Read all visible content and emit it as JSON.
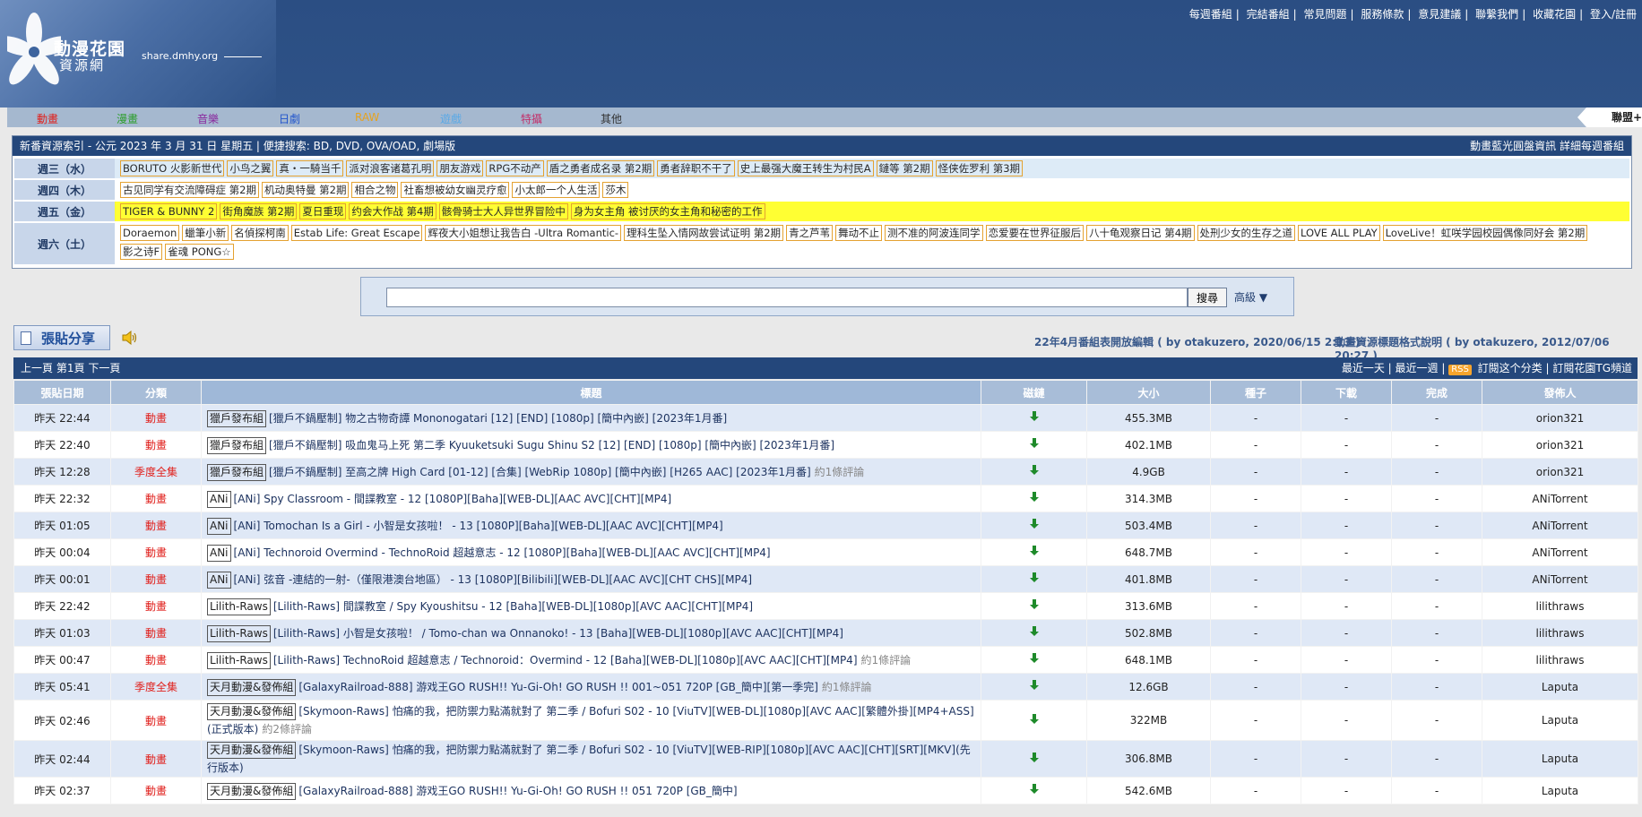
{
  "site": {
    "logo_title": "動漫花園",
    "logo_sub": "資源網",
    "domain": "share.dmhy.org"
  },
  "toplinks": [
    "每週番組",
    "完結番組",
    "常見問題",
    "服務條款",
    "意見建議",
    "聯繫我們",
    "收藏花園",
    "登入/註冊"
  ],
  "nav": [
    {
      "label": "動畫",
      "color": "#e0211d"
    },
    {
      "label": "漫畫",
      "color": "#2f9e2f"
    },
    {
      "label": "音樂",
      "color": "#8a2a9e"
    },
    {
      "label": "日劇",
      "color": "#2255cc"
    },
    {
      "label": "RAW",
      "color": "#e6a21e"
    },
    {
      "label": "遊戲",
      "color": "#5aa9e6"
    },
    {
      "label": "特攝",
      "color": "#c2306a"
    },
    {
      "label": "其他",
      "color": "#333333"
    }
  ],
  "nav_right": "聯盟+",
  "schedule": {
    "header_left": "新番資源索引 - 公元 2023 年 3 月 31 日 星期五 | 便捷搜索: BD, DVD, OVA/OAD, 劇場版",
    "header_right": "動畫藍光圓盤資訊 詳細每週番組",
    "rows": [
      {
        "day": "週三（水）",
        "items": [
          "BORUTO 火影新世代",
          "小鸟之翼",
          "真・一騎当千",
          "派对浪客诸葛孔明",
          "朋友游戏",
          "RPG不动产",
          "盾之勇者成名录 第2期",
          "勇者辞职不干了",
          "史上最强大魔王转生为村民A",
          "鏈等 第2期",
          "怪侠佐罗利 第3期"
        ]
      },
      {
        "day": "週四（木）",
        "items": [
          "古见同学有交流障碍症 第2期",
          "机动奥特曼 第2期",
          "相合之物",
          "社畜想被幼女幽灵疗愈",
          "小太郎一个人生活",
          "莎木"
        ]
      },
      {
        "day": "週五（金）",
        "items": [
          "TIGER & BUNNY 2",
          "街角魔族 第2期",
          "夏日重现",
          "约会大作战 第4期",
          "骸骨骑士大人异世界冒险中",
          "身为女主角 被讨厌的女主角和秘密的工作"
        ]
      },
      {
        "day": "週六（土）",
        "items": [
          "Doraemon",
          "蠟筆小新",
          "名偵探柯南",
          "Estab Life: Great Escape",
          "辉夜大小姐想让我告白 -Ultra Romantic-",
          "理科生坠入情网故尝试证明 第2期",
          "青之芦苇",
          "舞动不止",
          "测不准的阿波连同学",
          "恋爱要在世界征服后",
          "八十龟观察日记 第4期",
          "处刑少女的生存之道",
          "LOVE ALL PLAY",
          "LoveLive！虹咲学园校园偶像同好会 第2期",
          "影之诗F",
          "雀魂 PONG☆"
        ]
      }
    ]
  },
  "search": {
    "value": "",
    "button": "搜尋",
    "advanced": "高級 ▼"
  },
  "post_button": "張貼分享",
  "notices": [
    "22年4月番組表開放編輯 ( by otakuzero, 2020/06/15 2:13 )",
    "動畫資源標題格式說明 ( by otakuzero, 2012/07/06 20:27 )"
  ],
  "list": {
    "pager": [
      "上一頁",
      "第1頁",
      "下一頁"
    ],
    "right_links": [
      "最近一天",
      "最近一週"
    ],
    "rss_label": "RSS",
    "subscribe": "訂閱这个分类",
    "tg": "訂閱花園TG頻道",
    "headers": [
      "張貼日期",
      "分類",
      "標題",
      "磁鏈",
      "大小",
      "種子",
      "下載",
      "完成",
      "發佈人"
    ],
    "rows": [
      {
        "date": "昨天 22:44",
        "cat": "動畫",
        "team": "獵戶發布組",
        "title": "[獵戶不鍋壓制] 物之古物奇譚 Mononogatari [12] [END] [1080p] [簡中內嵌] [2023年1月番]",
        "comments": "",
        "size": "455.3MB",
        "seed": "-",
        "dl": "-",
        "done": "-",
        "pub": "orion321"
      },
      {
        "date": "昨天 22:40",
        "cat": "動畫",
        "team": "獵戶發布組",
        "title": "[獵戶不鍋壓制] 吸血鬼马上死 第二季 Kyuuketsuki Sugu Shinu S2 [12] [END] [1080p] [簡中內嵌] [2023年1月番]",
        "comments": "",
        "size": "402.1MB",
        "seed": "-",
        "dl": "-",
        "done": "-",
        "pub": "orion321"
      },
      {
        "date": "昨天 12:28",
        "cat": "季度全集",
        "team": "獵戶發布組",
        "title": "[獵戶不鍋壓制] 至高之牌 High Card [01-12] [合集] [WebRip 1080p] [簡中內嵌] [H265 AAC] [2023年1月番]",
        "comments": "約1條評論",
        "size": "4.9GB",
        "seed": "-",
        "dl": "-",
        "done": "-",
        "pub": "orion321"
      },
      {
        "date": "昨天 22:32",
        "cat": "動畫",
        "team": "ANi",
        "title": "[ANi] Spy Classroom - 間諜教室 - 12 [1080P][Baha][WEB-DL][AAC AVC][CHT][MP4]",
        "comments": "",
        "size": "314.3MB",
        "seed": "-",
        "dl": "-",
        "done": "-",
        "pub": "ANiTorrent"
      },
      {
        "date": "昨天 01:05",
        "cat": "動畫",
        "team": "ANi",
        "title": "[ANi] Tomochan Is a Girl - 小智是女孩啦！ - 13 [1080P][Baha][WEB-DL][AAC AVC][CHT][MP4]",
        "comments": "",
        "size": "503.4MB",
        "seed": "-",
        "dl": "-",
        "done": "-",
        "pub": "ANiTorrent"
      },
      {
        "date": "昨天 00:04",
        "cat": "動畫",
        "team": "ANi",
        "title": "[ANi] Technoroid Overmind - TechnoRoid 超越意志 - 12 [1080P][Baha][WEB-DL][AAC AVC][CHT][MP4]",
        "comments": "",
        "size": "648.7MB",
        "seed": "-",
        "dl": "-",
        "done": "-",
        "pub": "ANiTorrent"
      },
      {
        "date": "昨天 00:01",
        "cat": "動畫",
        "team": "ANi",
        "title": "[ANi] 弦音 -連結的一射-（僅限港澳台地區） - 13 [1080P][Bilibili][WEB-DL][AAC AVC][CHT CHS][MP4]",
        "comments": "",
        "size": "401.8MB",
        "seed": "-",
        "dl": "-",
        "done": "-",
        "pub": "ANiTorrent"
      },
      {
        "date": "昨天 22:42",
        "cat": "動畫",
        "team": "Lilith-Raws",
        "title": "[Lilith-Raws] 間諜教室 / Spy Kyoushitsu - 12 [Baha][WEB-DL][1080p][AVC AAC][CHT][MP4]",
        "comments": "",
        "size": "313.6MB",
        "seed": "-",
        "dl": "-",
        "done": "-",
        "pub": "lilithraws"
      },
      {
        "date": "昨天 01:03",
        "cat": "動畫",
        "team": "Lilith-Raws",
        "title": "[Lilith-Raws] 小智是女孩啦！ / Tomo-chan wa Onnanoko! - 13 [Baha][WEB-DL][1080p][AVC AAC][CHT][MP4]",
        "comments": "",
        "size": "502.8MB",
        "seed": "-",
        "dl": "-",
        "done": "-",
        "pub": "lilithraws"
      },
      {
        "date": "昨天 00:47",
        "cat": "動畫",
        "team": "Lilith-Raws",
        "title": "[Lilith-Raws] TechnoRoid 超越意志 / Technoroid：Overmind - 12 [Baha][WEB-DL][1080p][AVC AAC][CHT][MP4]",
        "comments": "約1條評論",
        "size": "648.1MB",
        "seed": "-",
        "dl": "-",
        "done": "-",
        "pub": "lilithraws"
      },
      {
        "date": "昨天 05:41",
        "cat": "季度全集",
        "team": "天月動漫&發佈組",
        "title": "[GalaxyRailroad-888] 游戏王GO RUSH!! Yu-Gi-Oh! GO RUSH !! 001~051 720P [GB_簡中][第一季完]",
        "comments": "約1條評論",
        "size": "12.6GB",
        "seed": "-",
        "dl": "-",
        "done": "-",
        "pub": "Laputa"
      },
      {
        "date": "昨天 02:46",
        "cat": "動畫",
        "team": "天月動漫&發佈組",
        "title": "[Skymoon-Raws] 怕痛的我，把防禦力點滿就對了 第二季 / Bofuri S02 - 10 [ViuTV][WEB-DL][1080p][AVC AAC][繁體外掛][MP4+ASS](正式版本)",
        "comments": "約2條評論",
        "size": "322MB",
        "seed": "-",
        "dl": "-",
        "done": "-",
        "pub": "Laputa",
        "tall": true
      },
      {
        "date": "昨天 02:44",
        "cat": "動畫",
        "team": "天月動漫&發佈組",
        "title": "[Skymoon-Raws] 怕痛的我，把防禦力點滿就對了 第二季 / Bofuri S02 - 10 [ViuTV][WEB-RIP][1080p][AVC AAC][CHT][SRT][MKV](先行版本)",
        "comments": "",
        "size": "306.8MB",
        "seed": "-",
        "dl": "-",
        "done": "-",
        "pub": "Laputa"
      },
      {
        "date": "昨天 02:37",
        "cat": "動畫",
        "team": "天月動漫&發佈組",
        "title": "[GalaxyRailroad-888] 游戏王GO RUSH!! Yu-Gi-Oh! GO RUSH !! 051 720P [GB_簡中]",
        "comments": "",
        "size": "542.6MB",
        "seed": "-",
        "dl": "-",
        "done": "-",
        "pub": "Laputa"
      }
    ]
  },
  "colors": {
    "header_bg": "#2c4f85",
    "nav_bg": "#a5b8cf",
    "table_head_bg": "#24477b",
    "row_alt": "#dfe8f6",
    "category_red": "#e0211d",
    "tag_border": "#e4a231",
    "friday_highlight": "#ffff33"
  },
  "icons": {
    "download": "down-arrow-icon",
    "speaker": "speaker-icon",
    "post": "document-icon",
    "rss": "rss-icon"
  }
}
